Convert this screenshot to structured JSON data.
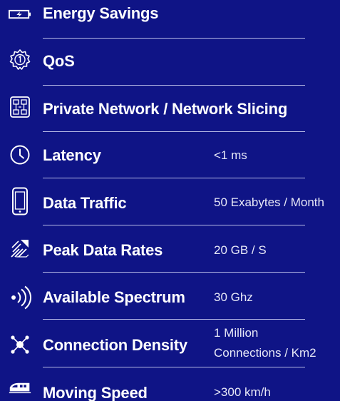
{
  "metrics": [
    {
      "icon": "battery-bolt-icon",
      "label": "Energy Savings",
      "value": ""
    },
    {
      "icon": "qos-badge-icon",
      "label": "QoS",
      "value": ""
    },
    {
      "icon": "network-slice-icon",
      "label": "Private Network / Network Slicing",
      "value": ""
    },
    {
      "icon": "clock-icon",
      "label": "Latency",
      "value": "<1 ms"
    },
    {
      "icon": "smartphone-icon",
      "label": "Data Traffic",
      "value": "50 Exabytes / Month"
    },
    {
      "icon": "speed-arrows-icon",
      "label": "Peak Data Rates",
      "value": "20 GB / S"
    },
    {
      "icon": "signal-waves-icon",
      "label": "Available Spectrum",
      "value": "30 Ghz"
    },
    {
      "icon": "connection-hub-icon",
      "label": "Connection Density",
      "value_line1": "1 Million",
      "value_line2": "Connections / Km2"
    },
    {
      "icon": "train-icon",
      "label": "Moving Speed",
      "value": ">300 km/h"
    }
  ],
  "colors": {
    "background": "#0f1486",
    "text": "#ffffff",
    "divider": "#b7bae6"
  }
}
